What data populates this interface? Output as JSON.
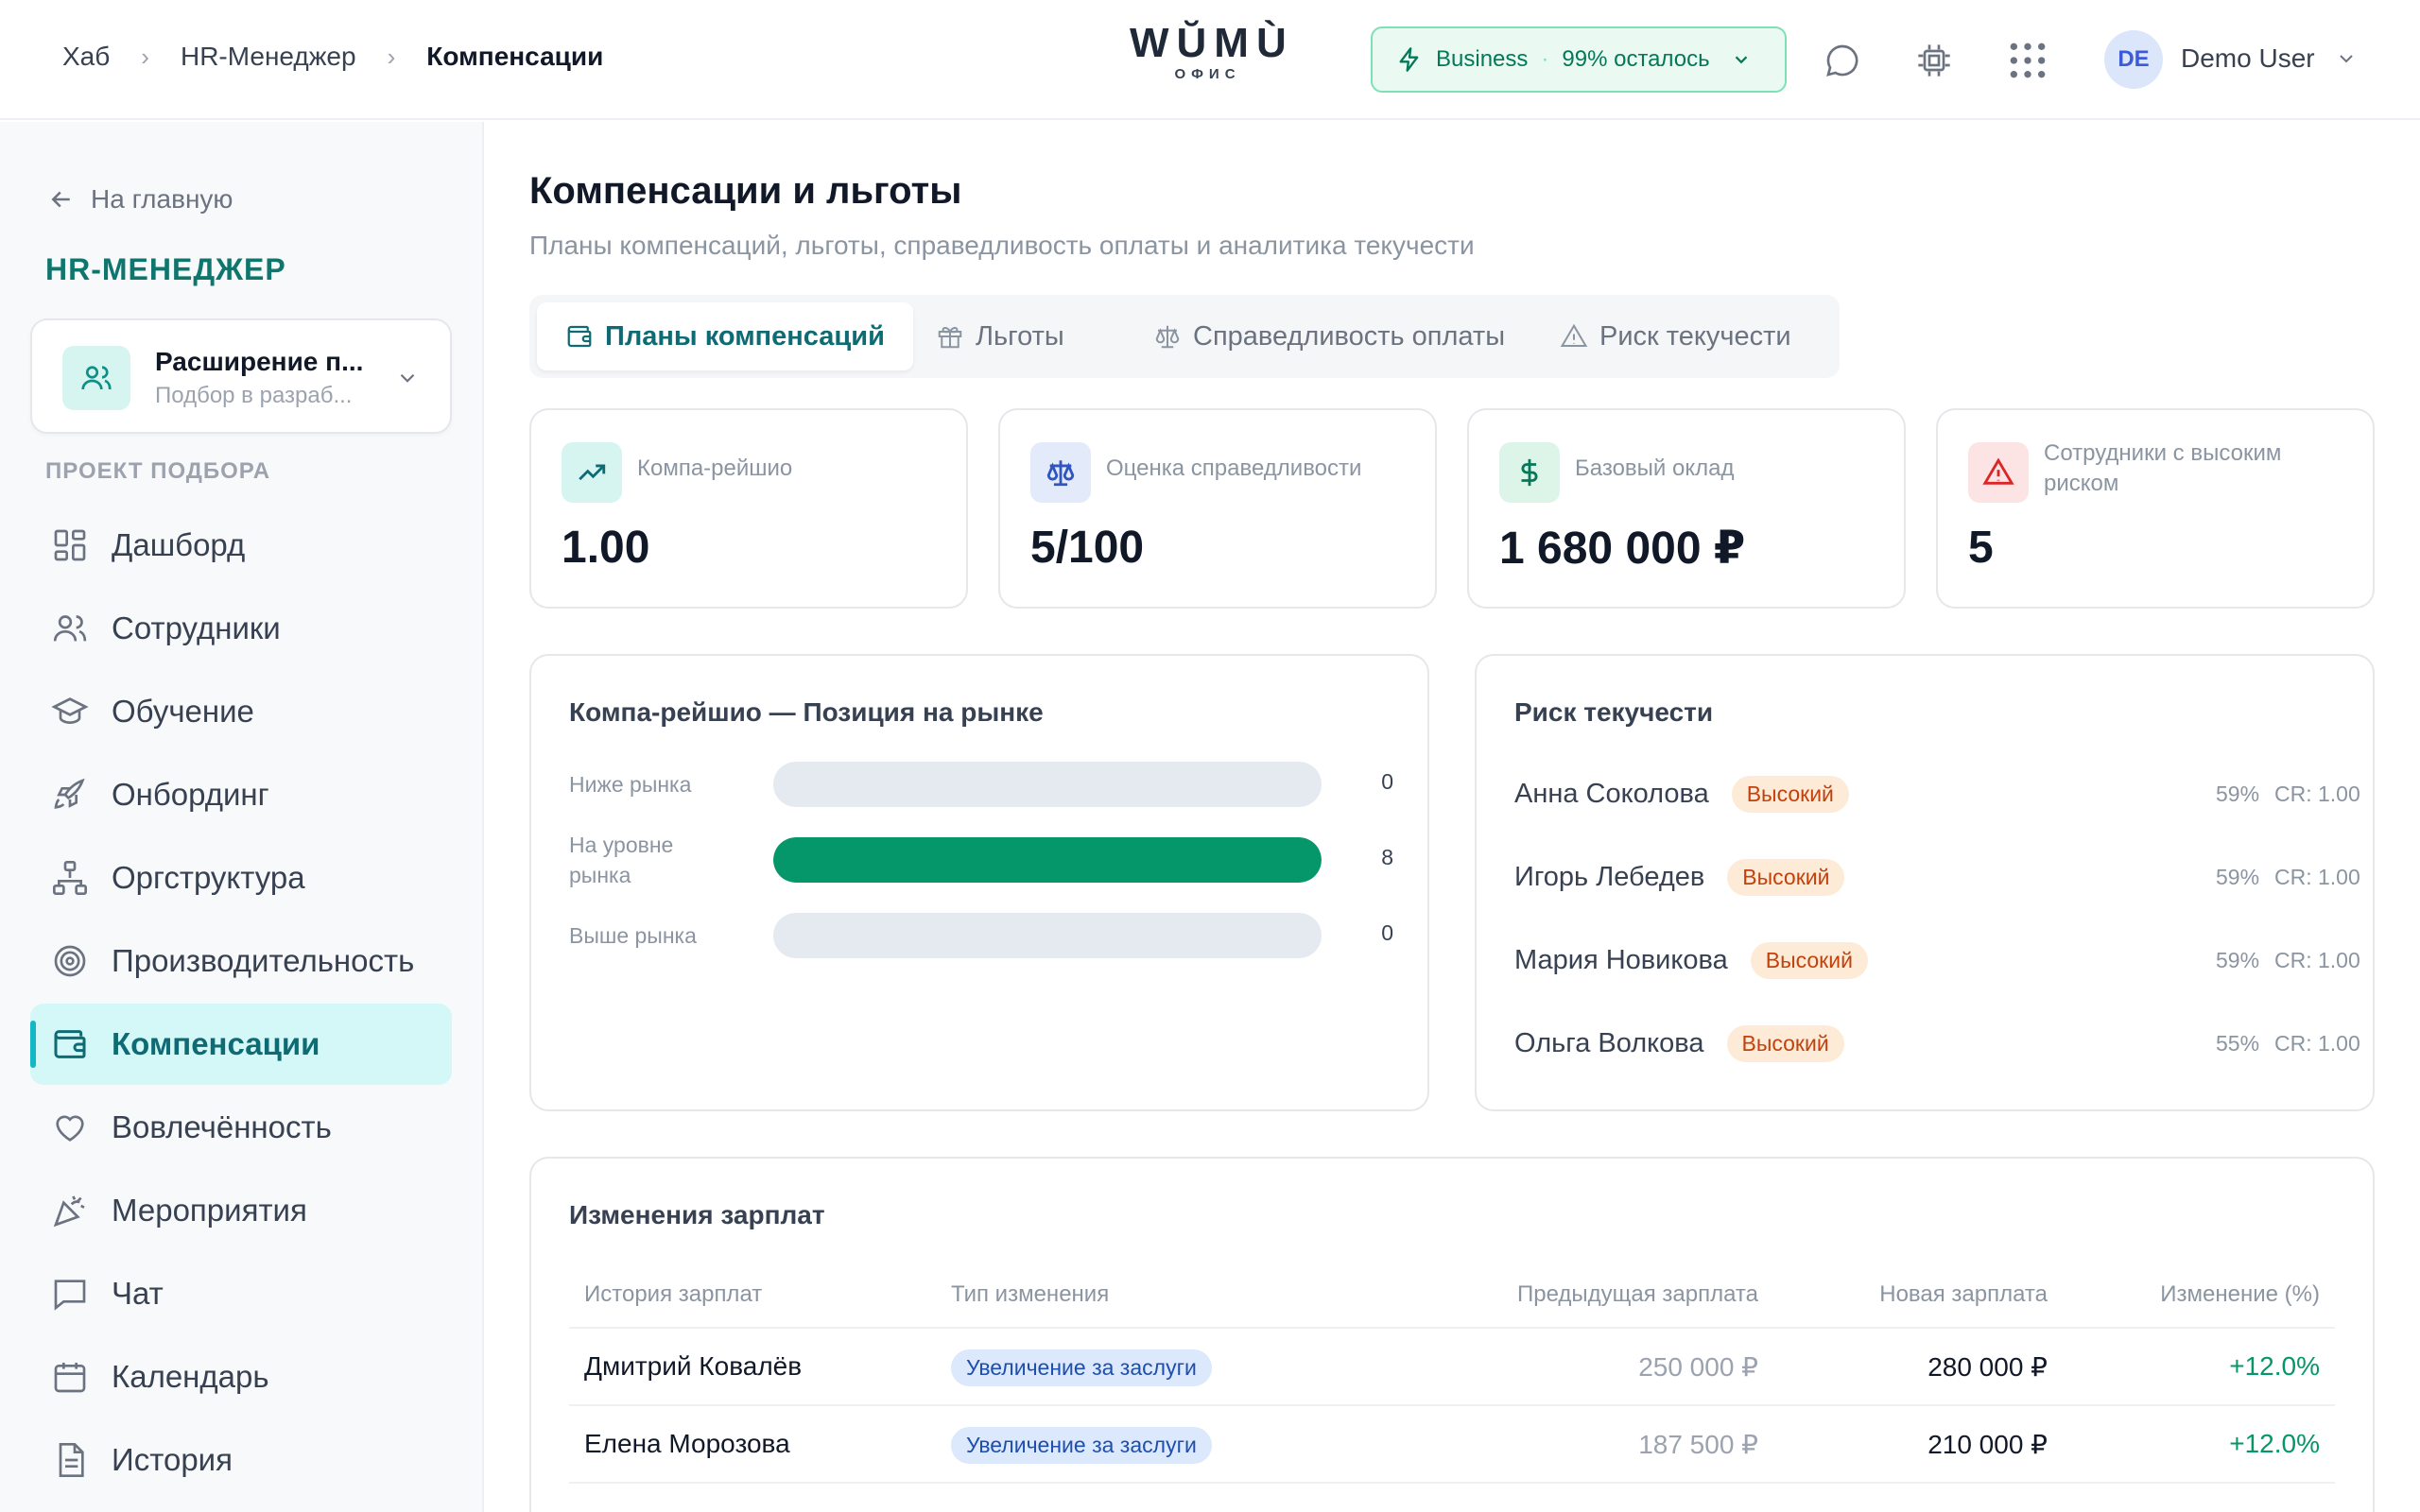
{
  "breadcrumb": {
    "items": [
      "Хаб",
      "HR-Менеджер"
    ],
    "current": "Компенсации"
  },
  "logo": {
    "main": "WŬMÙ",
    "sub": "ОФИС"
  },
  "plan": {
    "name": "Business",
    "remaining": "99% осталось"
  },
  "user": {
    "initials": "DE",
    "name": "Demo User"
  },
  "sidebar": {
    "back": "На главную",
    "section_title": "HR-МЕНЕДЖЕР",
    "project": {
      "name": "Расширение п...",
      "sub": "Подбор в разраб..."
    },
    "group_label": "ПРОЕКТ ПОДБОРА",
    "items": [
      {
        "label": "Дашборд",
        "icon": "dashboard-icon"
      },
      {
        "label": "Сотрудники",
        "icon": "users-icon"
      },
      {
        "label": "Обучение",
        "icon": "graduation-cap-icon"
      },
      {
        "label": "Онбординг",
        "icon": "rocket-icon"
      },
      {
        "label": "Оргструктура",
        "icon": "org-chart-icon"
      },
      {
        "label": "Производительность",
        "icon": "target-icon"
      },
      {
        "label": "Компенсации",
        "icon": "wallet-icon",
        "active": true
      },
      {
        "label": "Вовлечённость",
        "icon": "heart-icon"
      },
      {
        "label": "Мероприятия",
        "icon": "party-popper-icon"
      },
      {
        "label": "Чат",
        "icon": "chat-icon"
      },
      {
        "label": "Календарь",
        "icon": "calendar-icon"
      },
      {
        "label": "История",
        "icon": "document-icon"
      }
    ]
  },
  "main": {
    "title": "Компенсации и льготы",
    "subtitle": "Планы компенсаций, льготы, справедливость оплаты и аналитика текучести",
    "tabs": [
      {
        "label": "Планы компенсаций",
        "active": true
      },
      {
        "label": "Льготы"
      },
      {
        "label": "Справедливость оплаты"
      },
      {
        "label": "Риск текучести"
      }
    ],
    "stats": [
      {
        "label": "Компа-рейшио",
        "value": "1.00"
      },
      {
        "label": "Оценка справедливости",
        "value": "5/100"
      },
      {
        "label": "Базовый оклад",
        "value": "1 680 000 ₽"
      },
      {
        "label": "Сотрудники с высоким риском",
        "value": "5"
      }
    ],
    "market_panel": {
      "title": "Компа-рейшио — Позиция на рынке",
      "rows": [
        {
          "label": "Ниже рынка",
          "count": 0,
          "fill": 0.0
        },
        {
          "label": "На уровне рынка",
          "count": 8,
          "fill": 1.0
        },
        {
          "label": "Выше рынка",
          "count": 0,
          "fill": 0.0
        }
      ]
    },
    "risk_panel": {
      "title": "Риск текучести",
      "rows": [
        {
          "name": "Анна Соколова",
          "level": "Высокий",
          "pct": "59%",
          "cr": "CR: 1.00"
        },
        {
          "name": "Игорь Лебедев",
          "level": "Высокий",
          "pct": "59%",
          "cr": "CR: 1.00"
        },
        {
          "name": "Мария Новикова",
          "level": "Высокий",
          "pct": "59%",
          "cr": "CR: 1.00"
        },
        {
          "name": "Ольга Волкова",
          "level": "Высокий",
          "pct": "55%",
          "cr": "CR: 1.00"
        }
      ]
    },
    "salary_table": {
      "title": "Изменения зарплат",
      "headers": [
        "История зарплат",
        "Тип изменения",
        "Предыдущая зарплата",
        "Новая зарплата",
        "Изменение (%)"
      ],
      "rows": [
        {
          "name": "Дмитрий Ковалёв",
          "type": "Увеличение за заслуги",
          "prev": "250 000 ₽",
          "new": "280 000 ₽",
          "change": "+12.0%"
        },
        {
          "name": "Елена Морозова",
          "type": "Увеличение за заслуги",
          "prev": "187 500 ₽",
          "new": "210 000 ₽",
          "change": "+12.0%"
        }
      ]
    }
  },
  "colors": {
    "accent": "#0e6b73",
    "success": "#059669",
    "risk": "#c2410c"
  }
}
